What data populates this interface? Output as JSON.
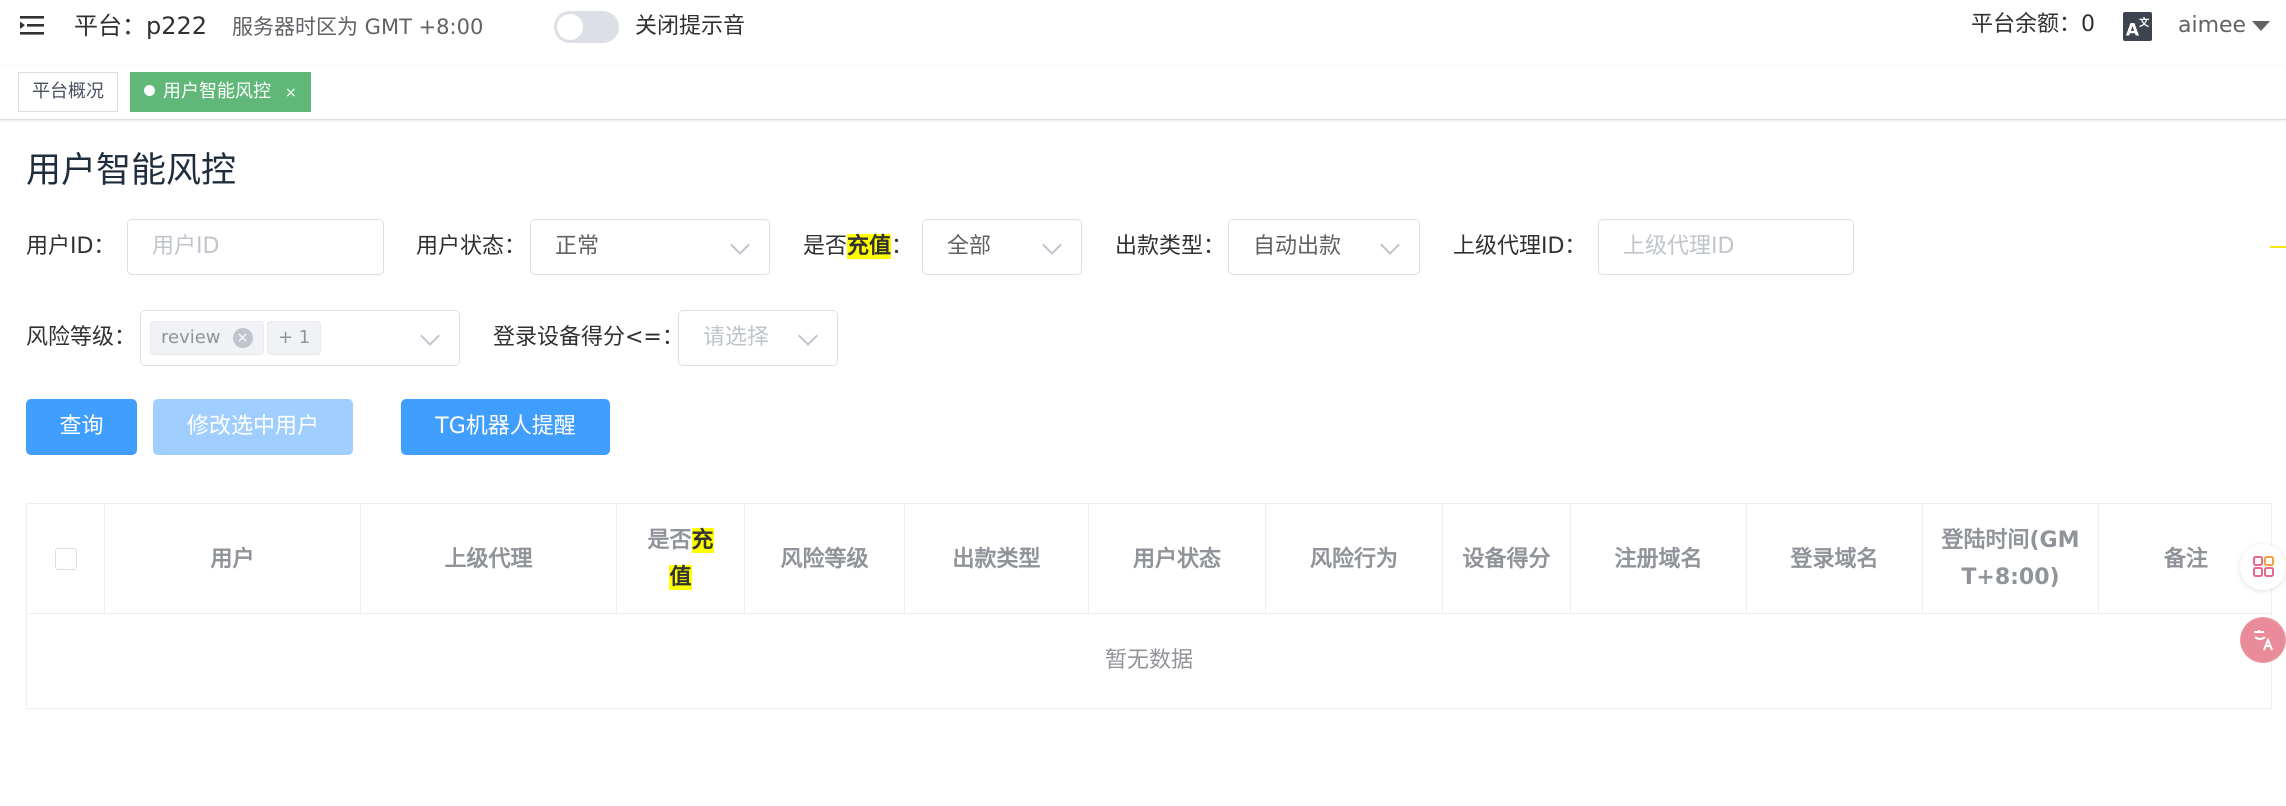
{
  "header": {
    "platform": "平台：p222",
    "timezone": "服务器时区为 GMT +8:00",
    "sound_toggle_label": "关闭提示音",
    "balance": "平台余额：0",
    "lang_icon": "A",
    "lang_icon_sup": "文",
    "username": "aimee"
  },
  "tags": [
    {
      "label": "平台概况",
      "active": false
    },
    {
      "label": "用户智能风控",
      "active": true,
      "close": "×"
    }
  ],
  "page_title": "用户智能风控",
  "filters": {
    "user_id_label": "用户ID：",
    "user_id_placeholder": "用户ID",
    "status_label": "用户状态：",
    "status_value": "正常",
    "recharge_label_pre": "是否",
    "recharge_label_hl": "充值",
    "recharge_label_post": "：",
    "recharge_value": "全部",
    "payout_label": "出款类型：",
    "payout_value": "自动出款",
    "agent_id_label": "上级代理ID：",
    "agent_id_placeholder": "上级代理ID",
    "risk_level_label": "风险等级：",
    "risk_level_tags": [
      "review",
      "+ 1"
    ],
    "device_score_label": "登录设备得分<=：",
    "device_score_placeholder": "请选择"
  },
  "buttons": {
    "query": "查询",
    "modify_selected": "修改选中用户",
    "tg_remind": "TG机器人提醒"
  },
  "table": {
    "columns": {
      "user": "用户",
      "agent": "上级代理",
      "recharge_pre": "是否",
      "recharge_hl1": "充",
      "recharge_hl2": "值",
      "risk_level": "风险等级",
      "payout_type": "出款类型",
      "user_status": "用户状态",
      "risk_behavior": "风险行为",
      "device_score": "设备得分",
      "register_domain": "注册域名",
      "login_domain": "登录域名",
      "login_time_1": "登陆时间(GM",
      "login_time_2": "T+8:00)",
      "remark": "备注"
    },
    "empty_text": "暂无数据"
  },
  "colors": {
    "primary": "#409eff",
    "primary_disabled": "#a0cfff",
    "tag_active": "#5fb878",
    "highlight": "#ffff00"
  }
}
